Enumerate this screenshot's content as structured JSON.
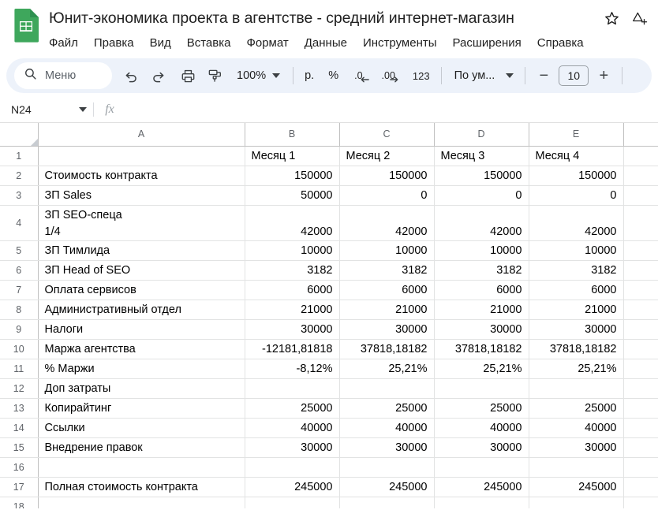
{
  "app": {
    "doc_icon": "sheets-document-icon",
    "title": "Юнит-экономика проекта в агентстве - средний интернет-магазин",
    "star_icon": "star-icon",
    "move_icon": "move-to-drive-icon"
  },
  "menu": {
    "items": [
      {
        "label": "Файл"
      },
      {
        "label": "Правка"
      },
      {
        "label": "Вид"
      },
      {
        "label": "Вставка"
      },
      {
        "label": "Формат"
      },
      {
        "label": "Данные"
      },
      {
        "label": "Инструменты"
      },
      {
        "label": "Расширения"
      },
      {
        "label": "Справка"
      }
    ]
  },
  "toolbar": {
    "search_label": "Меню",
    "search_icon": "search-icon",
    "undo_icon": "undo-icon",
    "redo_icon": "redo-icon",
    "print_icon": "print-icon",
    "paint_format_icon": "paint-format-icon",
    "zoom_value": "100%",
    "currency_label": "р.",
    "percent_label": "%",
    "decrease_decimal_label": ".0",
    "increase_decimal_label": ".00",
    "number_format_label": "123",
    "font_name": "По ум...",
    "font_size_decrease": "−",
    "font_size_value": "10",
    "font_size_increase": "+"
  },
  "formula_bar": {
    "name_box_value": "N24",
    "fx_label": "fx",
    "formula_value": ""
  },
  "sheet": {
    "columns": [
      "A",
      "B",
      "C",
      "D",
      "E",
      ""
    ],
    "rows": [
      {
        "num": "1",
        "cells": [
          "",
          "Месяц 1",
          "Месяц 2",
          "Месяц 3",
          "Месяц 4",
          ""
        ],
        "bold": true
      },
      {
        "num": "2",
        "cells": [
          "Стоимость контракта",
          "150000",
          "150000",
          "150000",
          "150000",
          ""
        ],
        "bold": false
      },
      {
        "num": "3",
        "cells": [
          "ЗП Sales",
          "50000",
          "0",
          "0",
          "0",
          ""
        ],
        "bold": false
      },
      {
        "num": "4",
        "cells": [
          "ЗП SEO-спеца\n1/4",
          "42000",
          "42000",
          "42000",
          "42000",
          ""
        ],
        "bold": false,
        "tall": true
      },
      {
        "num": "5",
        "cells": [
          "ЗП Тимлида",
          "10000",
          "10000",
          "10000",
          "10000",
          ""
        ],
        "bold": false
      },
      {
        "num": "6",
        "cells": [
          "ЗП Head of SEO",
          "3182",
          "3182",
          "3182",
          "3182",
          ""
        ],
        "bold": false
      },
      {
        "num": "7",
        "cells": [
          "Оплата сервисов",
          "6000",
          "6000",
          "6000",
          "6000",
          ""
        ],
        "bold": false
      },
      {
        "num": "8",
        "cells": [
          "Административный отдел",
          "21000",
          "21000",
          "21000",
          "21000",
          ""
        ],
        "bold": false
      },
      {
        "num": "9",
        "cells": [
          "Налоги",
          "30000",
          "30000",
          "30000",
          "30000",
          ""
        ],
        "bold": true,
        "label_bold": false
      },
      {
        "num": "10",
        "cells": [
          "Маржа агентства",
          "-12181,81818",
          "37818,18182",
          "37818,18182",
          "37818,18182",
          ""
        ],
        "bold": true
      },
      {
        "num": "11",
        "cells": [
          "% Маржи",
          "-8,12%",
          "25,21%",
          "25,21%",
          "25,21%",
          ""
        ],
        "bold": false
      },
      {
        "num": "12",
        "cells": [
          "Доп затраты",
          "",
          "",
          "",
          "",
          ""
        ],
        "bold": true
      },
      {
        "num": "13",
        "cells": [
          "Копирайтинг",
          "25000",
          "25000",
          "25000",
          "25000",
          ""
        ],
        "bold": false
      },
      {
        "num": "14",
        "cells": [
          "Ссылки",
          "40000",
          "40000",
          "40000",
          "40000",
          ""
        ],
        "bold": false
      },
      {
        "num": "15",
        "cells": [
          "Внедрение правок",
          "30000",
          "30000",
          "30000",
          "30000",
          ""
        ],
        "bold": false
      },
      {
        "num": "16",
        "cells": [
          "",
          "",
          "",
          "",
          "",
          ""
        ],
        "bold": false
      },
      {
        "num": "17",
        "cells": [
          "Полная стоимость контракта",
          "245000",
          "245000",
          "245000",
          "245000",
          ""
        ],
        "bold": false,
        "label_bold": true
      },
      {
        "num": "18",
        "cells": [
          "",
          "",
          "",
          "",
          "",
          ""
        ],
        "bold": false
      }
    ]
  },
  "colors": {
    "brand_green": "#3ea75c",
    "toolbar_bg": "#edf2fa",
    "grid_line": "#e2e3e3",
    "header_line": "#c0c0c0",
    "text": "#1f1f1f",
    "muted_text": "#5f6368"
  }
}
